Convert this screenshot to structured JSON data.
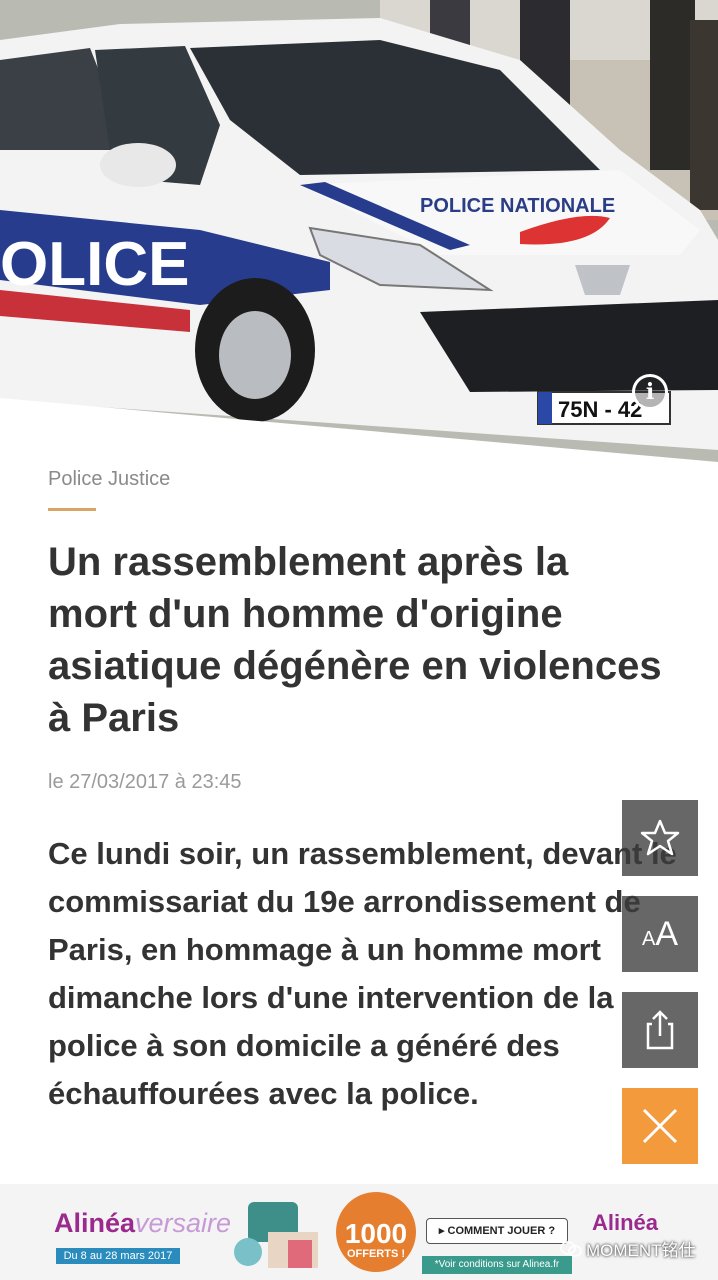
{
  "hero": {
    "plate_text": "75N - 42",
    "car_livery": "POLICE",
    "car_badge": "POLICE NATIONALE",
    "info_glyph": "i"
  },
  "article": {
    "category": "Police Justice",
    "headline": "Un rassemblement après la mort d'un homme d'origine asiatique dégénère en violences à Paris",
    "date": "le 27/03/2017 à 23:45",
    "lead": "Ce lundi soir, un rassemblement, devant le commissariat du 19e arrondissement de Paris, en hommage à un homme mort dimanche lors d'une intervention de la police à son domicile a généré des échauffourées avec la police."
  },
  "actions": {
    "favorite_icon": "star-icon",
    "font_small": "A",
    "font_big": "A",
    "share_icon": "share-icon",
    "close_icon": "close-icon"
  },
  "ad": {
    "logo_main": "Alinéa",
    "logo_accent": "versaire",
    "dates": "Du 8 au 28 mars 2017",
    "circle_number": "1000",
    "circle_text": "OFFERTS !",
    "cta": "▸ COMMENT JOUER ?",
    "conditions": "*Voir conditions sur Alinea.fr",
    "logo_right": "Alinéa"
  },
  "watermark": {
    "text": "MOMENT铭仕"
  },
  "colors": {
    "accent_rule": "#d8a468",
    "close_button": "#f29a3c",
    "text_dark": "#333333"
  }
}
